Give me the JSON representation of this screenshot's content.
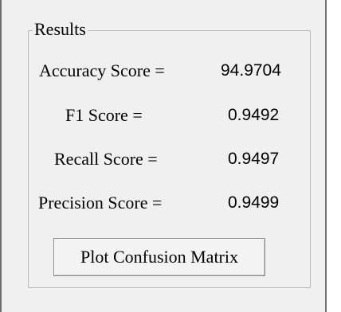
{
  "results": {
    "title": "Results",
    "rows": [
      {
        "label": "Accuracy Score =",
        "value": "94.9704"
      },
      {
        "label": "F1 Score =",
        "value": "0.9492"
      },
      {
        "label": "Recall Score =",
        "value": "0.9497"
      },
      {
        "label": "Precision Score =",
        "value": "0.9499"
      }
    ],
    "plot_button_label": "Plot Confusion Matrix"
  }
}
